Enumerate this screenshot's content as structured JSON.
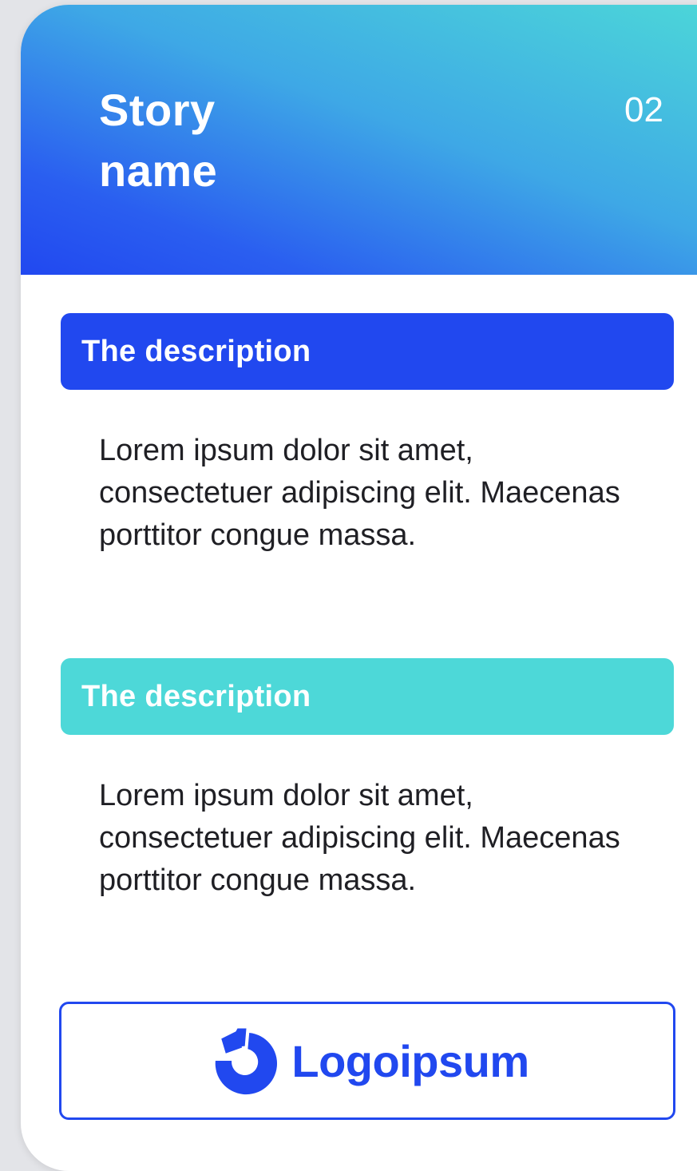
{
  "header": {
    "title": "Story name",
    "number": "02"
  },
  "sections": [
    {
      "heading": "The description",
      "text": "Lorem ipsum dolor sit amet, consectetuer adipiscing elit. Maecenas porttitor congue massa.",
      "color": "#2148ef"
    },
    {
      "heading": "The description",
      "text": "Lorem ipsum dolor sit amet, consectetuer adipiscing elit. Maecenas porttitor congue massa.",
      "color": "#4dd8d8"
    }
  ],
  "logo": {
    "icon": "logo-mark-icon",
    "text": "Logoipsum",
    "color": "#2148ef"
  },
  "colors": {
    "gradient_start": "#4cd7d8",
    "gradient_end": "#2148f0",
    "text": "#1f1f24"
  }
}
